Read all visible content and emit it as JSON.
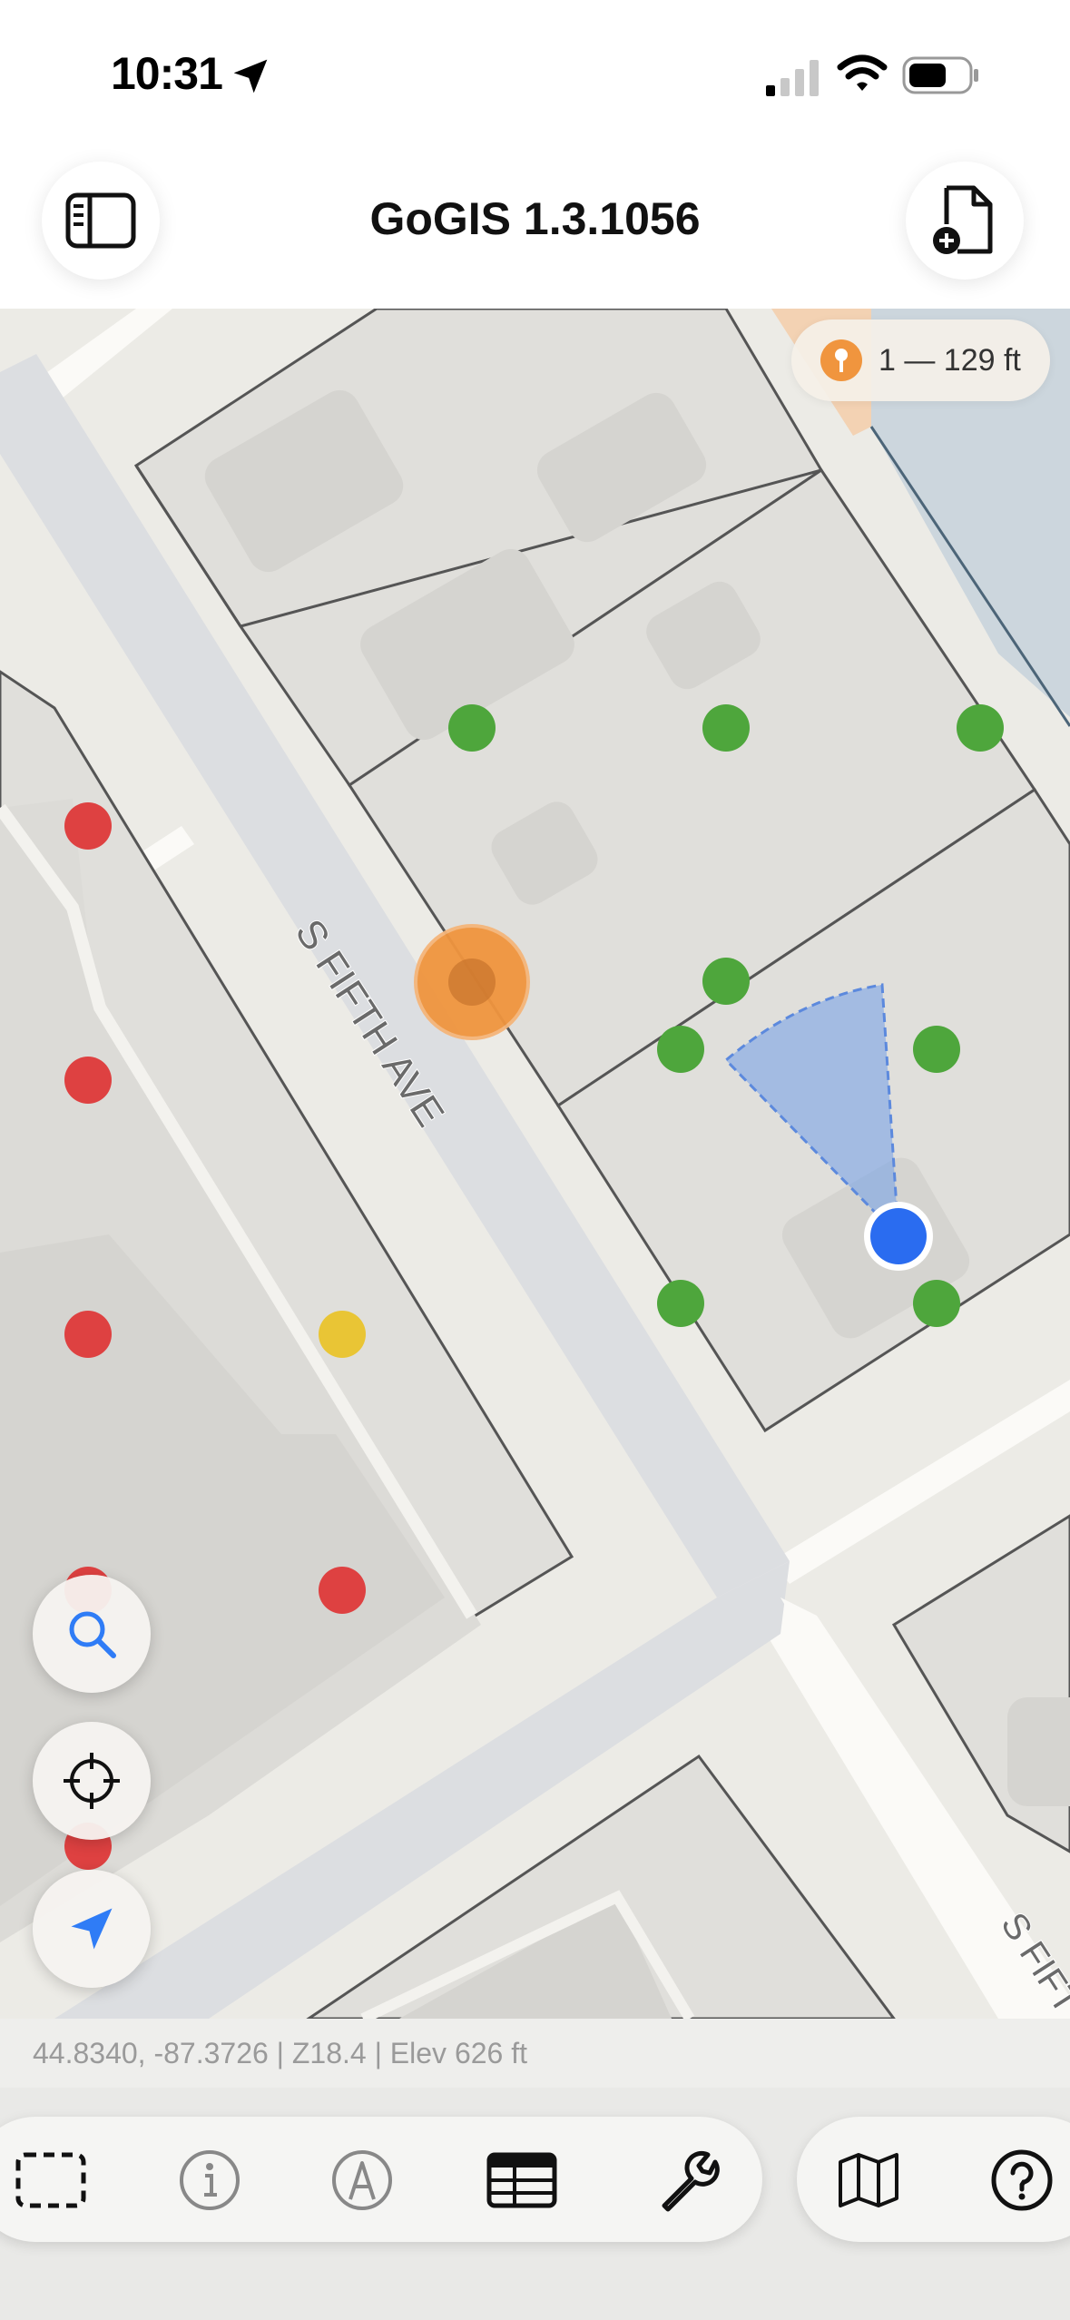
{
  "status_bar": {
    "time": "10:31",
    "icons": [
      "location-arrow-icon",
      "cellular-signal-icon",
      "wifi-icon",
      "battery-icon"
    ]
  },
  "header": {
    "title": "GoGIS 1.3.1056",
    "left_button_icon": "sidebar-icon",
    "right_button_icon": "new-document-icon"
  },
  "map": {
    "scale_label": "1 — 129 ft",
    "street_labels": [
      "S FIFTH AVE",
      "S FIFT"
    ],
    "colors": {
      "green_point": "#4ea63c",
      "red_point": "#de4141",
      "yellow_point": "#e9c535",
      "orange_marker": "#f0953e",
      "user_location": "#2a6cf0",
      "heading_cone": "#7aa3e6"
    }
  },
  "map_controls": [
    "search-icon",
    "crosshair-icon",
    "navigation-arrow-icon"
  ],
  "coordinates_readout": "44.8340, -87.3726 | Z18.4 | Elev 626 ft",
  "toolbar": {
    "tools": [
      "select-rectangle-icon",
      "info-icon",
      "draw-icon",
      "table-icon",
      "wrench-icon"
    ],
    "secondary_tools": [
      "map-icon",
      "help-icon"
    ]
  }
}
